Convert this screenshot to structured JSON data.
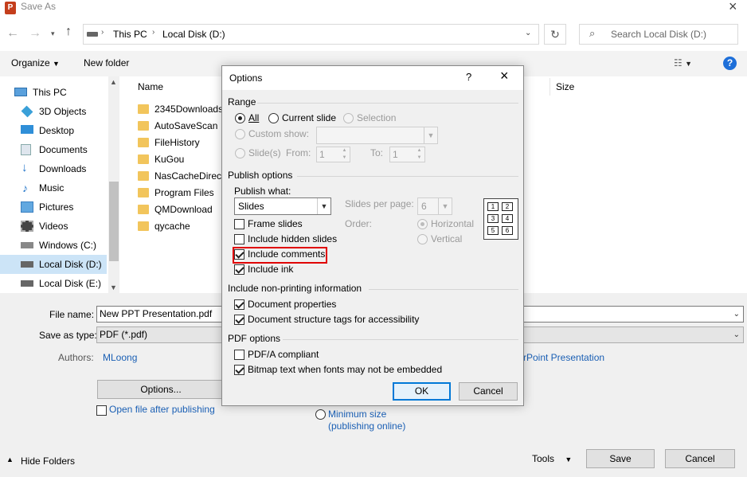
{
  "window": {
    "title": "Save As",
    "app_icon_letter": "P"
  },
  "address": {
    "segments": [
      "This PC",
      "Local Disk (D:)"
    ],
    "search_placeholder": "Search Local Disk (D:)"
  },
  "toolbar": {
    "organize": "Organize",
    "new_folder": "New folder"
  },
  "nav": {
    "items": [
      {
        "label": "This PC",
        "icon": "pc-icon"
      },
      {
        "label": "3D Objects",
        "icon": "cube-icon"
      },
      {
        "label": "Desktop",
        "icon": "desktop-icon"
      },
      {
        "label": "Documents",
        "icon": "documents-icon"
      },
      {
        "label": "Downloads",
        "icon": "download-icon"
      },
      {
        "label": "Music",
        "icon": "music-icon"
      },
      {
        "label": "Pictures",
        "icon": "pictures-icon"
      },
      {
        "label": "Videos",
        "icon": "video-icon"
      },
      {
        "label": "Windows (C:)",
        "icon": "drive-icon"
      },
      {
        "label": "Local Disk (D:)",
        "icon": "drive-icon"
      },
      {
        "label": "Local Disk (E:)",
        "icon": "drive-icon"
      }
    ]
  },
  "files": {
    "col_name": "Name",
    "col_size": "Size",
    "items": [
      "2345Downloads",
      "AutoSaveScan",
      "FileHistory",
      "KuGou",
      "NasCacheDirect",
      "Program Files",
      "QMDownload",
      "qycache"
    ]
  },
  "form": {
    "filename_label": "File name:",
    "filename_value": "New PPT Presentation.pdf",
    "type_label": "Save as type:",
    "type_value": "PDF (*.pdf)",
    "authors_label": "Authors:",
    "authors_value": "MLoong",
    "tags_fragment": "rPoint Presentation",
    "options_button": "Options...",
    "open_after": "Open file after publishing",
    "minimum_size": "Minimum size",
    "publishing_online": "(publishing online)",
    "hide_folders": "Hide Folders",
    "tools": "Tools",
    "save": "Save",
    "cancel": "Cancel"
  },
  "dialog": {
    "title": "Options",
    "help": "?",
    "range": {
      "heading": "Range",
      "all": "All",
      "current_slide": "Current slide",
      "selection": "Selection",
      "custom_show": "Custom show:",
      "slides": "Slide(s)",
      "from": "From:",
      "from_value": "1",
      "to": "To:",
      "to_value": "1"
    },
    "publish": {
      "heading": "Publish options",
      "publish_what": "Publish what:",
      "publish_value": "Slides",
      "slides_per_page": "Slides per page:",
      "spp_value": "6",
      "order": "Order:",
      "horizontal": "Horizontal",
      "vertical": "Vertical",
      "frame_slides": "Frame slides",
      "include_hidden": "Include hidden slides",
      "include_comments": "Include comments",
      "include_ink": "Include ink",
      "grid_numbers": [
        "1",
        "2",
        "3",
        "4",
        "5",
        "6"
      ]
    },
    "nonprint": {
      "heading": "Include non-printing information",
      "doc_props": "Document properties",
      "doc_tags": "Document structure tags for accessibility"
    },
    "pdf": {
      "heading": "PDF options",
      "pdfa": "PDF/A compliant",
      "bitmap": "Bitmap text when fonts may not be embedded"
    },
    "ok": "OK",
    "cancel": "Cancel"
  }
}
